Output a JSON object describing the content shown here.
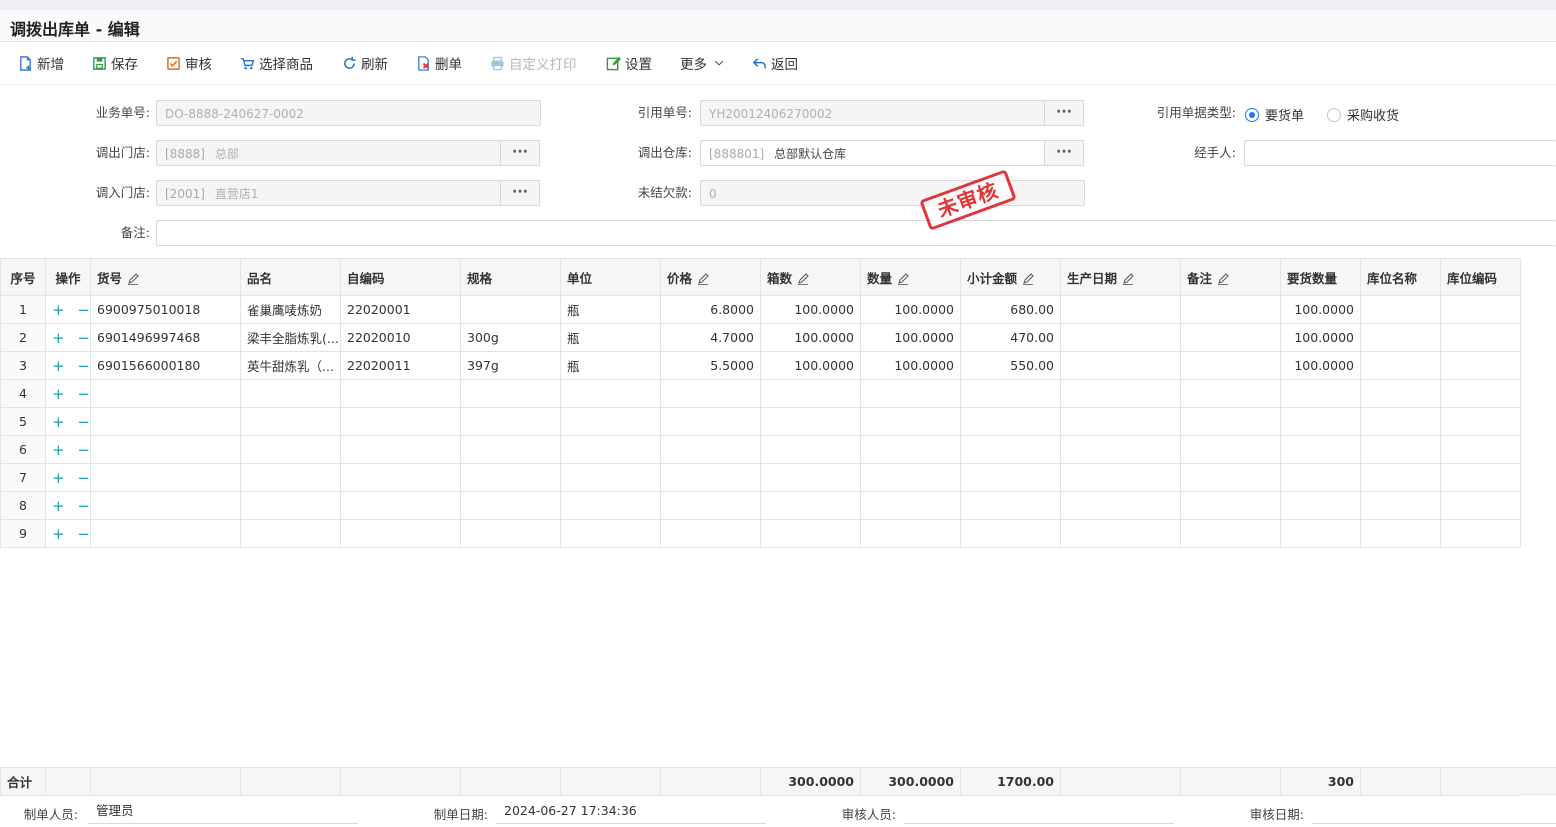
{
  "title": "调拨出库单 - 编辑",
  "toolbar": {
    "add": "新增",
    "save": "保存",
    "audit": "审核",
    "select_goods": "选择商品",
    "refresh": "刷新",
    "delete": "删单",
    "custom_print": "自定义打印",
    "settings": "设置",
    "more": "更多",
    "back": "返回"
  },
  "form": {
    "biz_no_label": "业务单号:",
    "biz_no": "DO-8888-240627-0002",
    "ref_no_label": "引用单号:",
    "ref_no": "YH20012406270002",
    "ref_type_label": "引用单据类型:",
    "ref_type_opt1": "要货单",
    "ref_type_opt2": "采购收货",
    "out_store_label": "调出门店:",
    "out_store_code": "[8888]",
    "out_store_name": "总部",
    "out_wh_label": "调出仓库:",
    "out_wh_code": "[888801]",
    "out_wh_name": "总部默认仓库",
    "handler_label": "经手人:",
    "in_store_label": "调入门店:",
    "in_store_code": "[2001]",
    "in_store_name": "直营店1",
    "unpaid_label": "未结欠款:",
    "unpaid": "0",
    "remark_label": "备注:",
    "dots": "···"
  },
  "stamp": "未审核",
  "grid": {
    "headers": {
      "no": "序号",
      "op": "操作",
      "sku": "货号",
      "name": "品名",
      "selfcode": "自编码",
      "spec": "规格",
      "unit": "单位",
      "price": "价格",
      "boxes": "箱数",
      "qty": "数量",
      "subtotal": "小计金额",
      "prod_date": "生产日期",
      "remark": "备注",
      "req_qty": "要货数量",
      "loc_name": "库位名称",
      "loc_code": "库位编码"
    },
    "op_symbols": "+ −",
    "row_numbers": [
      "1",
      "2",
      "3",
      "4",
      "5",
      "6",
      "7",
      "8",
      "9"
    ],
    "rows": [
      {
        "sku": "6900975010018",
        "name": "雀巢鹰唛炼奶",
        "selfcode": "22020001",
        "spec": "",
        "unit": "瓶",
        "price": "6.8000",
        "boxes": "100.0000",
        "qty": "100.0000",
        "subtotal": "680.00",
        "req_qty": "100.0000"
      },
      {
        "sku": "6901496997468",
        "name": "梁丰全脂炼乳(...",
        "selfcode": "22020010",
        "spec": "300g",
        "unit": "瓶",
        "price": "4.7000",
        "boxes": "100.0000",
        "qty": "100.0000",
        "subtotal": "470.00",
        "req_qty": "100.0000"
      },
      {
        "sku": "6901566000180",
        "name": "英牛甜炼乳（...",
        "selfcode": "22020011",
        "spec": "397g",
        "unit": "瓶",
        "price": "5.5000",
        "boxes": "100.0000",
        "qty": "100.0000",
        "subtotal": "550.00",
        "req_qty": "100.0000"
      }
    ]
  },
  "totals": {
    "label": "合计",
    "boxes": "300.0000",
    "qty": "300.0000",
    "subtotal": "1700.00",
    "req_qty": "300"
  },
  "footer": {
    "maker_label": "制单人员:",
    "maker": "管理员",
    "make_date_label": "制单日期:",
    "make_date": "2024-06-27 17:34:36",
    "auditor_label": "审核人员:",
    "auditor": "",
    "audit_date_label": "审核日期:",
    "audit_date": ""
  },
  "colors": {
    "accent": "#1677ff",
    "stamp": "#e0363a",
    "op": "#1aa0b5"
  }
}
